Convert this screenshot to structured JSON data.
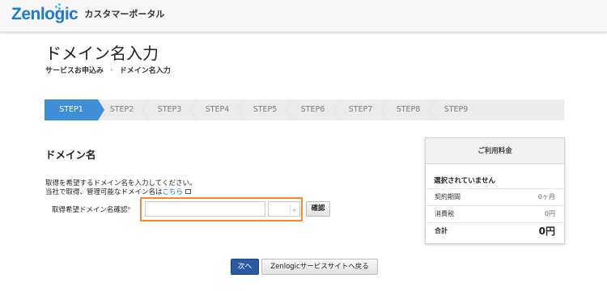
{
  "header": {
    "logo_text": "Zenlogic",
    "portal_title": "カスタマーポータル"
  },
  "page": {
    "title": "ドメイン名入力",
    "breadcrumb": [
      "サービスお申込み",
      "ドメイン名入力"
    ]
  },
  "steps": {
    "items": [
      "STEP1",
      "STEP2",
      "STEP3",
      "STEP4",
      "STEP5",
      "STEP6",
      "STEP7",
      "STEP8",
      "STEP9"
    ],
    "active_index": 0
  },
  "form": {
    "section_title": "ドメイン名",
    "desc_line1": "取得を希望するドメイン名を入力してください。",
    "desc_line2_prefix": "当社で取得、管理可能なドメイン名は",
    "desc_link": "こちら",
    "field_label": "取得希望ドメイン名確認",
    "required_mark": "*",
    "name_value": "",
    "tld_value": "",
    "confirm_label": "確認"
  },
  "fee": {
    "title": "ご利用料金",
    "none_selected": "選択されていません",
    "rows": [
      {
        "label": "契約期間",
        "value": "0ヶ月"
      },
      {
        "label": "消費税",
        "value": "0円"
      }
    ],
    "total_label": "合計",
    "total_value": "0円"
  },
  "actions": {
    "next_label": "次へ",
    "back_label": "Zenlogicサービスサイトへ戻る"
  },
  "colors": {
    "brand": "#1f7bcf",
    "step_active": "#3f8fd6",
    "highlight": "#f08a3a",
    "primary_button": "#2c5aa0"
  }
}
